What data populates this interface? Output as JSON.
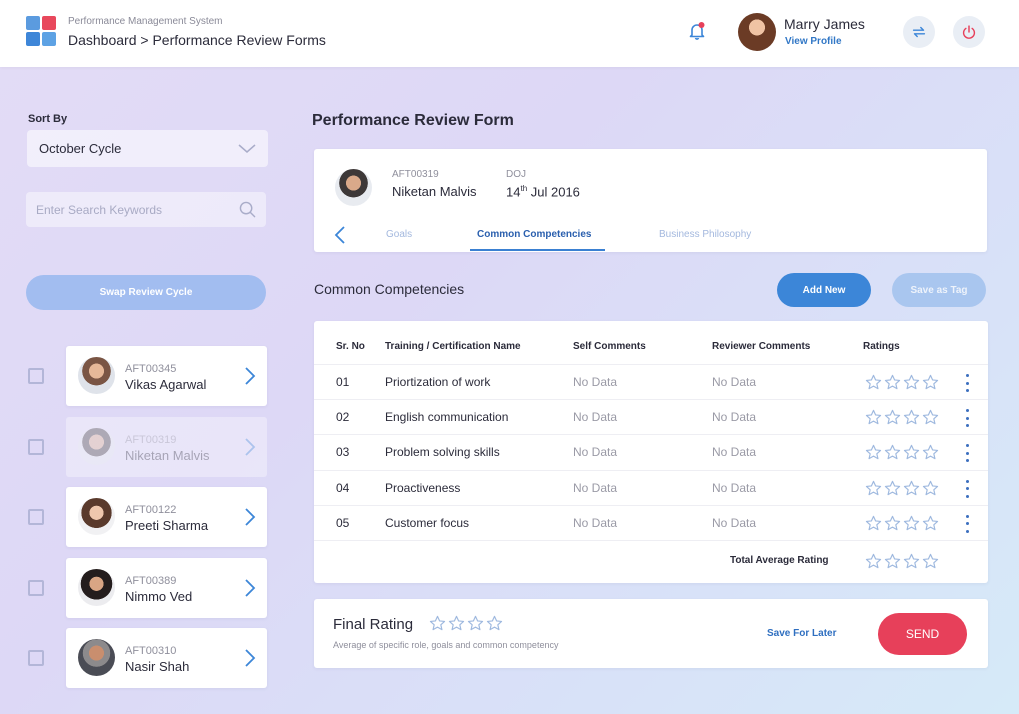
{
  "header": {
    "app_name": "Performance Management System",
    "breadcrumb": "Dashboard > Performance Review Forms",
    "user_name": "Marry James",
    "view_profile": "View Profile",
    "icons": [
      "bell-icon",
      "refresh-icon",
      "power-icon"
    ],
    "notification_dot_color": "#e7405a"
  },
  "sidebar": {
    "sort_label": "Sort By",
    "sort_value": "October Cycle",
    "search_placeholder": "Enter Search Keywords",
    "swap_button": "Swap Review Cycle",
    "employees": [
      {
        "id": "AFT00345",
        "name": "Vikas Agarwal",
        "selected": false,
        "dimmed": false
      },
      {
        "id": "AFT00319",
        "name": "Niketan Malvis",
        "selected": false,
        "dimmed": true
      },
      {
        "id": "AFT00122",
        "name": "Preeti Sharma",
        "selected": false,
        "dimmed": false
      },
      {
        "id": "AFT00389",
        "name": "Nimmo Ved",
        "selected": false,
        "dimmed": false
      },
      {
        "id": "AFT00310",
        "name": "Nasir Shah",
        "selected": false,
        "dimmed": false
      }
    ]
  },
  "main": {
    "title": "Performance Review Form",
    "employee": {
      "id": "AFT00319",
      "name": "Niketan Malvis",
      "doj_label": "DOJ",
      "doj_day": "14",
      "doj_suffix": "th",
      "doj_rest": " Jul 2016"
    },
    "tabs": [
      {
        "label": "Goals",
        "active": false
      },
      {
        "label": "Common Competencies",
        "active": true
      },
      {
        "label": "Business Philosophy",
        "active": false
      }
    ],
    "section_title": "Common Competencies",
    "add_new": "Add New",
    "save_as_tag": "Save as Tag",
    "table": {
      "headers": [
        "Sr. No",
        "Training / Certification Name",
        "Self Comments",
        "Reviewer Comments",
        "Ratings"
      ],
      "rows": [
        {
          "sr": "01",
          "name": "Priortization of work",
          "self": "No Data",
          "reviewer": "No Data",
          "rating": 0,
          "max_rating": 4
        },
        {
          "sr": "02",
          "name": "English communication",
          "self": "No Data",
          "reviewer": "No Data",
          "rating": 0,
          "max_rating": 4
        },
        {
          "sr": "03",
          "name": "Problem solving skills",
          "self": "No Data",
          "reviewer": "No Data",
          "rating": 0,
          "max_rating": 4
        },
        {
          "sr": "04",
          "name": "Proactiveness",
          "self": "No Data",
          "reviewer": "No Data",
          "rating": 0,
          "max_rating": 4
        },
        {
          "sr": "05",
          "name": "Customer focus",
          "self": "No Data",
          "reviewer": "No Data",
          "rating": 0,
          "max_rating": 4
        }
      ],
      "total_label": "Total Average Rating",
      "total_rating": 0
    },
    "final": {
      "title": "Final Rating",
      "subtitle": "Average of specific role, goals and common competency",
      "rating": 0,
      "save_later": "Save For Later",
      "send": "SEND"
    }
  },
  "colors": {
    "accent": "#3c86d8",
    "send": "#e7405a",
    "star_outline": "#9fb9df"
  }
}
